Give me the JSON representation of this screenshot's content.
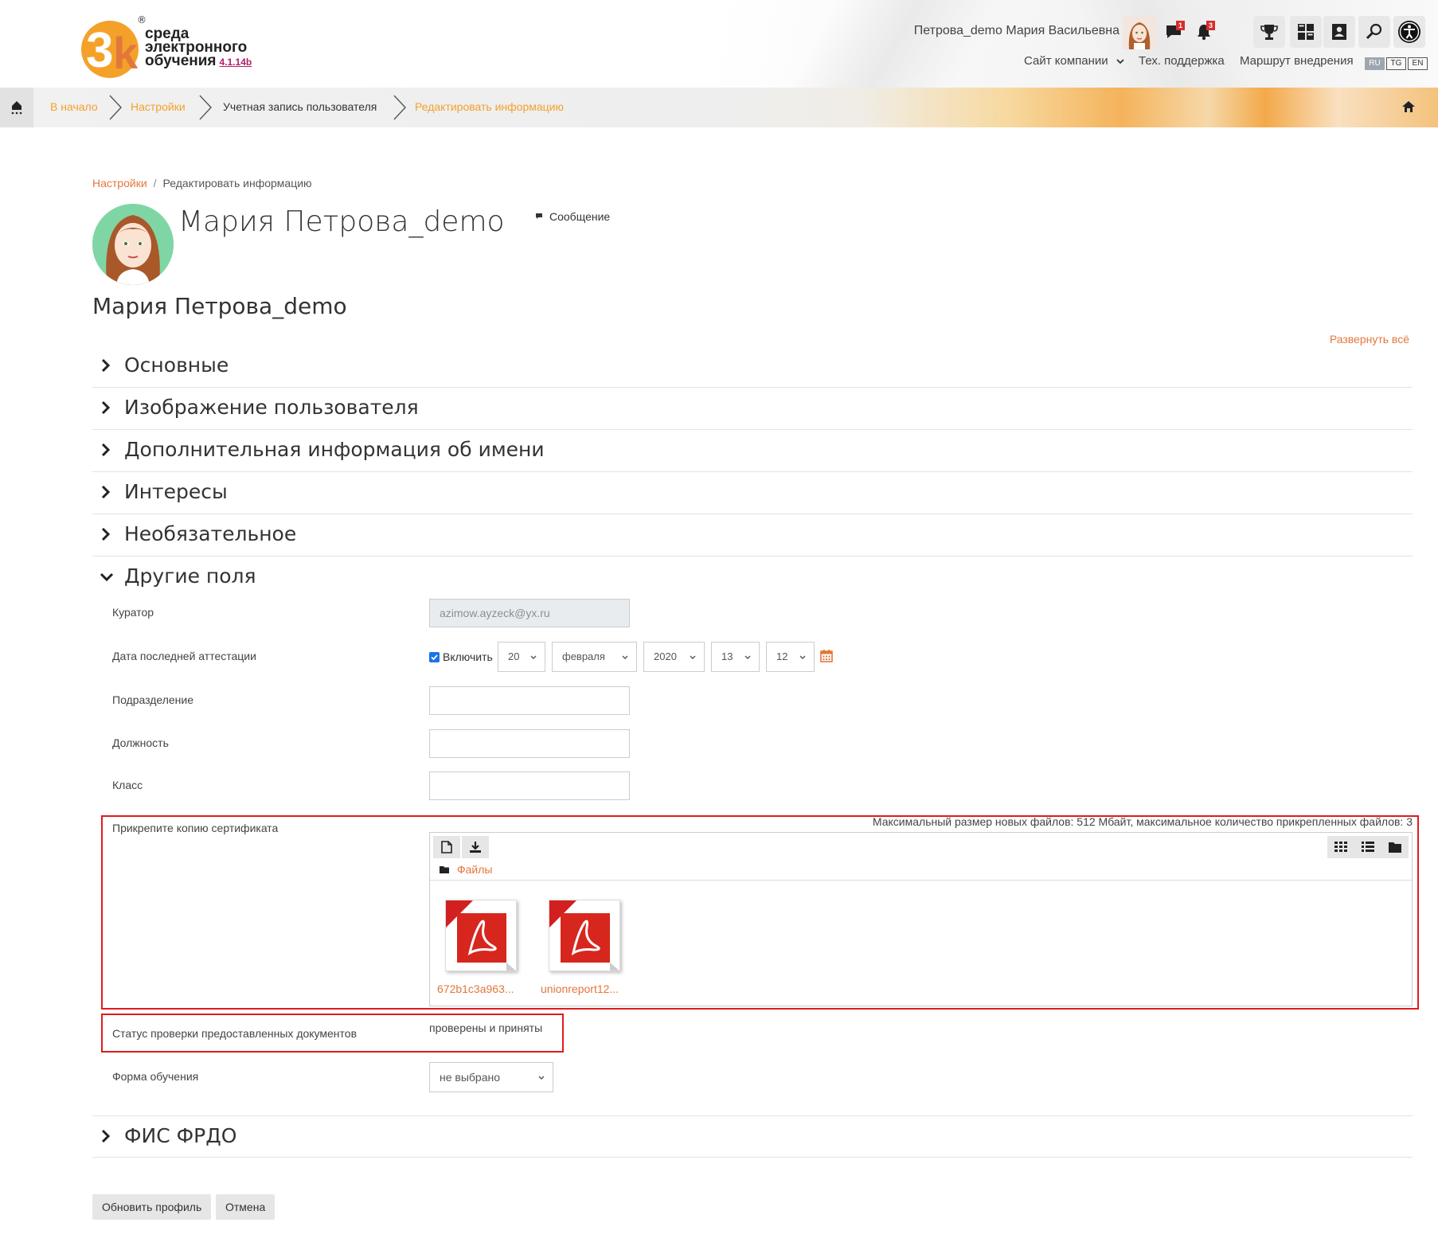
{
  "screen": {
    "width": 1806,
    "height": 1565
  },
  "brand": {
    "line1": "среда",
    "line2": "электронного",
    "line3": "обучения",
    "version": "4.1.14b",
    "reg": "®",
    "colors": {
      "orange": "#f4a12a",
      "accent": "#e2773b",
      "purple": "#b0206a"
    }
  },
  "header": {
    "user_name": "Петрова_demo Мария Васильевна",
    "messages_badge": "1",
    "notifications_badge": "3",
    "links": {
      "company_site": "Сайт компании",
      "support": "Тех. поддержка",
      "route": "Маршрут внедрения"
    },
    "languages": [
      "RU",
      "TG",
      "EN"
    ],
    "active_language": "RU",
    "tool_icons": [
      "trophy-icon",
      "dashboard-icon",
      "user-badge-icon",
      "search-icon",
      "accessibility-icon"
    ]
  },
  "crumbbar": {
    "items": [
      {
        "label": "В начало",
        "type": "link"
      },
      {
        "label": "Настройки",
        "type": "link"
      },
      {
        "label": "Учетная запись пользователя",
        "type": "plain"
      },
      {
        "label": "Редактировать информацию",
        "type": "link"
      }
    ]
  },
  "page": {
    "breadcrumb_link": "Настройки",
    "breadcrumb_current": "Редактировать информацию",
    "breadcrumb_sep": "/",
    "profile_name": "Мария Петрова_demo",
    "message_label": "Сообщение",
    "form_heading": "Мария Петрова_demo",
    "expand_all": "Развернуть всё"
  },
  "sections": {
    "main": "Основные",
    "picture": "Изображение пользователя",
    "extra_name": "Дополнительная информация об имени",
    "interests": "Интересы",
    "optional": "Необязательное",
    "other": "Другие поля",
    "fis": "ФИС ФРДО"
  },
  "fields": {
    "curator_label": "Куратор",
    "curator_value": "azimow.ayzeck@yx.ru",
    "attest_label": "Дата последней аттестации",
    "attest_enable": "Включить",
    "attest_day": "20",
    "attest_month": "февраля",
    "attest_year": "2020",
    "attest_hour": "13",
    "attest_minute": "12",
    "division_label": "Подразделение",
    "position_label": "Должность",
    "class_label": "Класс",
    "cert_label": "Прикрепите копию сертификата",
    "cert_note": "Максимальный размер новых файлов: 512 Мбайт, максимальное количество прикрепленных файлов: 3",
    "files_path": "Файлы",
    "files": [
      "672b1c3a963...",
      "unionreport12..."
    ],
    "status_label": "Статус проверки предоставленных документов",
    "status_value": "проверены и приняты",
    "form_label": "Форма обучения",
    "form_value": "не выбрано"
  },
  "buttons": {
    "update": "Обновить профиль",
    "cancel": "Отмена"
  }
}
